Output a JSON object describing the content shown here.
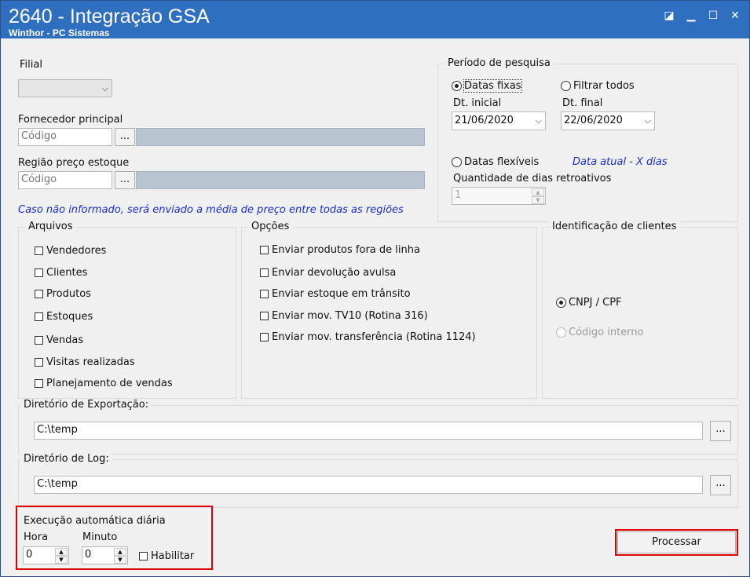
{
  "window": {
    "title": "2640 - Integração GSA",
    "subtitle": "Winthor - PC Sistemas",
    "icons": [
      "restore-small-icon",
      "minimize-icon",
      "maximize-icon",
      "close-icon"
    ]
  },
  "filial": {
    "label": "Filial",
    "value": ""
  },
  "fornecedor": {
    "label": "Fornecedor principal",
    "placeholder": "Código",
    "button": "..."
  },
  "regiao": {
    "label": "Região preço estoque",
    "placeholder": "Código",
    "button": "..."
  },
  "note_regioes": "Caso não informado, será enviado a média de preço entre todas as regiões",
  "periodo": {
    "title": "Período de pesquisa",
    "datas_fixas": "Datas fixas",
    "filtrar_todos": "Filtrar todos",
    "dt_inicial_label": "Dt. inicial",
    "dt_inicial": "21/06/2020",
    "dt_final_label": "Dt. final",
    "dt_final": "22/06/2020",
    "datas_flexiveis": "Datas flexíveis",
    "note": "Data atual - X dias",
    "qtd_label": "Quantidade de dias retroativos",
    "qtd_value": "1"
  },
  "arquivos": {
    "title": "Arquivos",
    "items": [
      "Vendedores",
      "Clientes",
      "Produtos",
      "Estoques",
      "Vendas",
      "Visitas realizadas",
      "Planejamento de vendas"
    ]
  },
  "opcoes": {
    "title": "Opções",
    "items": [
      "Enviar produtos fora de linha",
      "Enviar devolução avulsa",
      "Enviar estoque em trânsito",
      "Enviar mov. TV10 (Rotina 316)",
      "Enviar mov. transferência (Rotina 1124)"
    ]
  },
  "identificacao": {
    "title": "Identificação de clientes",
    "cnpj": "CNPJ / CPF",
    "codigo_interno": "Código interno"
  },
  "exportacao": {
    "title": "Diretório de Exportação:",
    "value": "C:\\temp",
    "button": "..."
  },
  "log": {
    "title": "Diretório de Log:",
    "value": "C:\\temp",
    "button": "..."
  },
  "execucao": {
    "title": "Execução automática diária",
    "hora_label": "Hora",
    "hora_value": "0",
    "minuto_label": "Minuto",
    "minuto_value": "0",
    "habilitar": "Habilitar"
  },
  "processar": "Processar",
  "colors": {
    "titlebar": "#2f6fbf",
    "highlight": "#e00000",
    "note": "#1a2fd0"
  }
}
